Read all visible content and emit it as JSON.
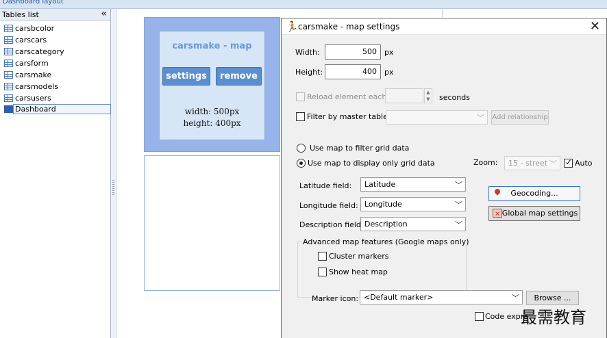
{
  "window": {
    "title": "Dashboard layout"
  },
  "tables_panel": {
    "header": "Tables list",
    "collapse_glyph": "«",
    "items": [
      {
        "label": "carsbcolor"
      },
      {
        "label": "carscars"
      },
      {
        "label": "carscategory"
      },
      {
        "label": "carsform"
      },
      {
        "label": "carsmake"
      },
      {
        "label": "carsmodels"
      },
      {
        "label": "carsusers"
      },
      {
        "label": "Dashboard",
        "selected": true
      }
    ]
  },
  "canvas": {
    "element": {
      "title": "carsmake - map",
      "settings_label": "settings",
      "remove_label": "remove",
      "width_text": "width: 500px",
      "height_text": "height: 400px"
    }
  },
  "dialog": {
    "title": "carsmake - map settings",
    "close_glyph": "✕",
    "width_label": "Width:",
    "width_value": "500",
    "height_label": "Height:",
    "height_value": "400",
    "px_unit": "px",
    "reload_label": "Reload element each",
    "seconds_label": "seconds",
    "filter_master_label": "Filter by master table",
    "add_relationship_label": "Add relationship",
    "radio_filter_label": "Use map to filter grid data",
    "radio_display_label": "Use map to display only grid data",
    "zoom_label": "Zoom:",
    "zoom_value": "15 - street",
    "auto_label": "Auto",
    "latitude_label": "Latitude field:",
    "latitude_value": "Latitude",
    "longitude_label": "Longitude field:",
    "longitude_value": "Longitude",
    "description_label": "Description field:",
    "description_value": "Description",
    "geocoding_label": "Geocoding...",
    "global_map_label": "Global map settings",
    "advanced_label": "Advanced map features (Google maps only)",
    "cluster_label": "Cluster markers",
    "heatmap_label": "Show heat map",
    "marker_icon_label": "Marker icon:",
    "marker_icon_value": "<Default marker>",
    "browse_label": "Browse ...",
    "code_expr_label": "Code expre"
  },
  "watermark": "最需教育",
  "colors": {
    "accent": "#5b8fd0",
    "selection_bg": "#97b4ea",
    "title_link": "#2a5b9e"
  }
}
